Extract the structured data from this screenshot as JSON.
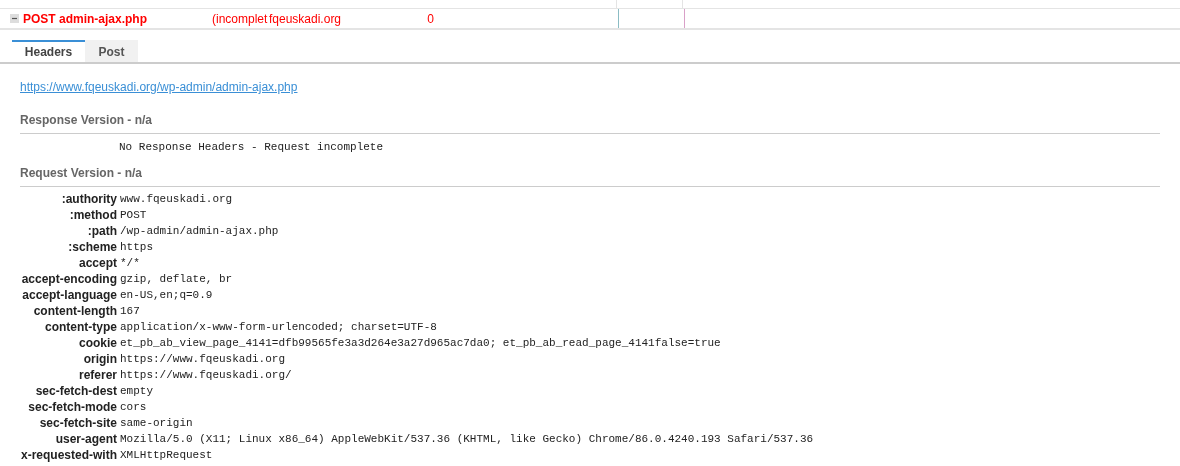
{
  "request_row": {
    "expanded": true,
    "name": "POST admin-ajax.php",
    "status": "(incomplet",
    "domain": "fqeuskadi.org",
    "size": "0"
  },
  "tabs": [
    {
      "label": "Headers",
      "selected": true
    },
    {
      "label": "Post",
      "selected": false
    }
  ],
  "url": "https://www.fqeuskadi.org/wp-admin/admin-ajax.php",
  "response": {
    "title": "Response Version - n/a",
    "message": "No Response Headers - Request incomplete"
  },
  "request": {
    "title": "Request Version - n/a",
    "headers": [
      {
        "name": ":authority",
        "value": "www.fqeuskadi.org"
      },
      {
        "name": ":method",
        "value": "POST"
      },
      {
        "name": ":path",
        "value": "/wp-admin/admin-ajax.php"
      },
      {
        "name": ":scheme",
        "value": "https"
      },
      {
        "name": "accept",
        "value": "*/*"
      },
      {
        "name": "accept-encoding",
        "value": "gzip, deflate, br"
      },
      {
        "name": "accept-language",
        "value": "en-US,en;q=0.9"
      },
      {
        "name": "content-length",
        "value": "167"
      },
      {
        "name": "content-type",
        "value": "application/x-www-form-urlencoded; charset=UTF-8"
      },
      {
        "name": "cookie",
        "value": "et_pb_ab_view_page_4141=dfb99565fe3a3d264e3a27d965ac7da0; et_pb_ab_read_page_4141false=true"
      },
      {
        "name": "origin",
        "value": "https://www.fqeuskadi.org"
      },
      {
        "name": "referer",
        "value": "https://www.fqeuskadi.org/"
      },
      {
        "name": "sec-fetch-dest",
        "value": "empty"
      },
      {
        "name": "sec-fetch-mode",
        "value": "cors"
      },
      {
        "name": "sec-fetch-site",
        "value": "same-origin"
      },
      {
        "name": "user-agent",
        "value": "Mozilla/5.0 (X11; Linux x86_64) AppleWebKit/537.36 (KHTML, like Gecko) Chrome/86.0.4240.193 Safari/537.36"
      },
      {
        "name": "x-requested-with",
        "value": "XMLHttpRequest"
      }
    ]
  }
}
